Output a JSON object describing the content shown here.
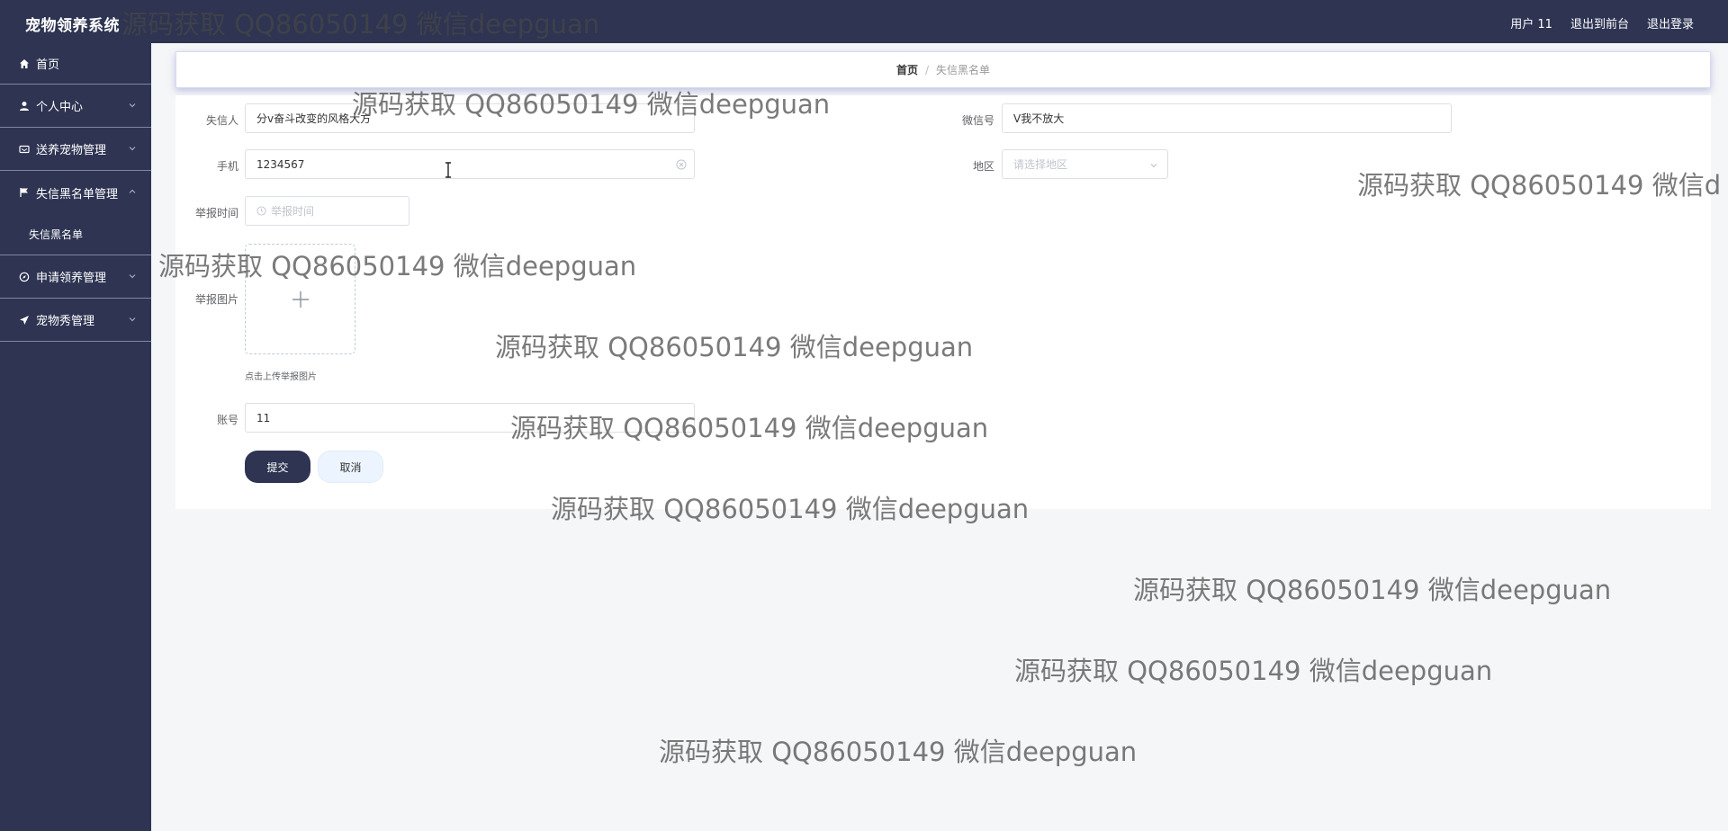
{
  "header": {
    "app_title": "宠物领养系统",
    "user_label": "用户 11",
    "to_front_label": "退出到前台",
    "logout_label": "退出登录"
  },
  "sidebar": {
    "items": [
      {
        "label": "首页",
        "icon": "home-icon"
      },
      {
        "label": "个人中心",
        "icon": "user-icon"
      },
      {
        "label": "送养宠物管理",
        "icon": "card-icon"
      },
      {
        "label": "失信黑名单管理",
        "icon": "flag-icon"
      },
      {
        "label": "失信黑名单",
        "icon": ""
      },
      {
        "label": "申请领养管理",
        "icon": "compass-icon"
      },
      {
        "label": "宠物秀管理",
        "icon": "send-icon"
      }
    ]
  },
  "breadcrumb": {
    "home": "首页",
    "separator": "/",
    "current": "失信黑名单"
  },
  "form": {
    "dishonest_person_label": "失信人",
    "dishonest_person_value": "分v奋斗改变的风格大方",
    "wechat_label": "微信号",
    "wechat_value": "V我不放大",
    "phone_label": "手机",
    "phone_value": "1234567",
    "region_label": "地区",
    "region_placeholder": "请选择地区",
    "report_time_label": "举报时间",
    "report_time_placeholder": "举报时间",
    "report_image_label": "举报图片",
    "upload_hint": "点击上传举报图片",
    "account_label": "账号",
    "account_value": "11",
    "submit_label": "提交",
    "cancel_label": "取消"
  },
  "watermark": {
    "text": "源码获取 QQ86050149 微信deepguan",
    "text_cut": "源码获取 QQ86050149 微信d"
  },
  "colors": {
    "sidebar_bg": "#2e3452",
    "primary_button": "#2e3452",
    "page_bg": "#f5f6f8"
  }
}
